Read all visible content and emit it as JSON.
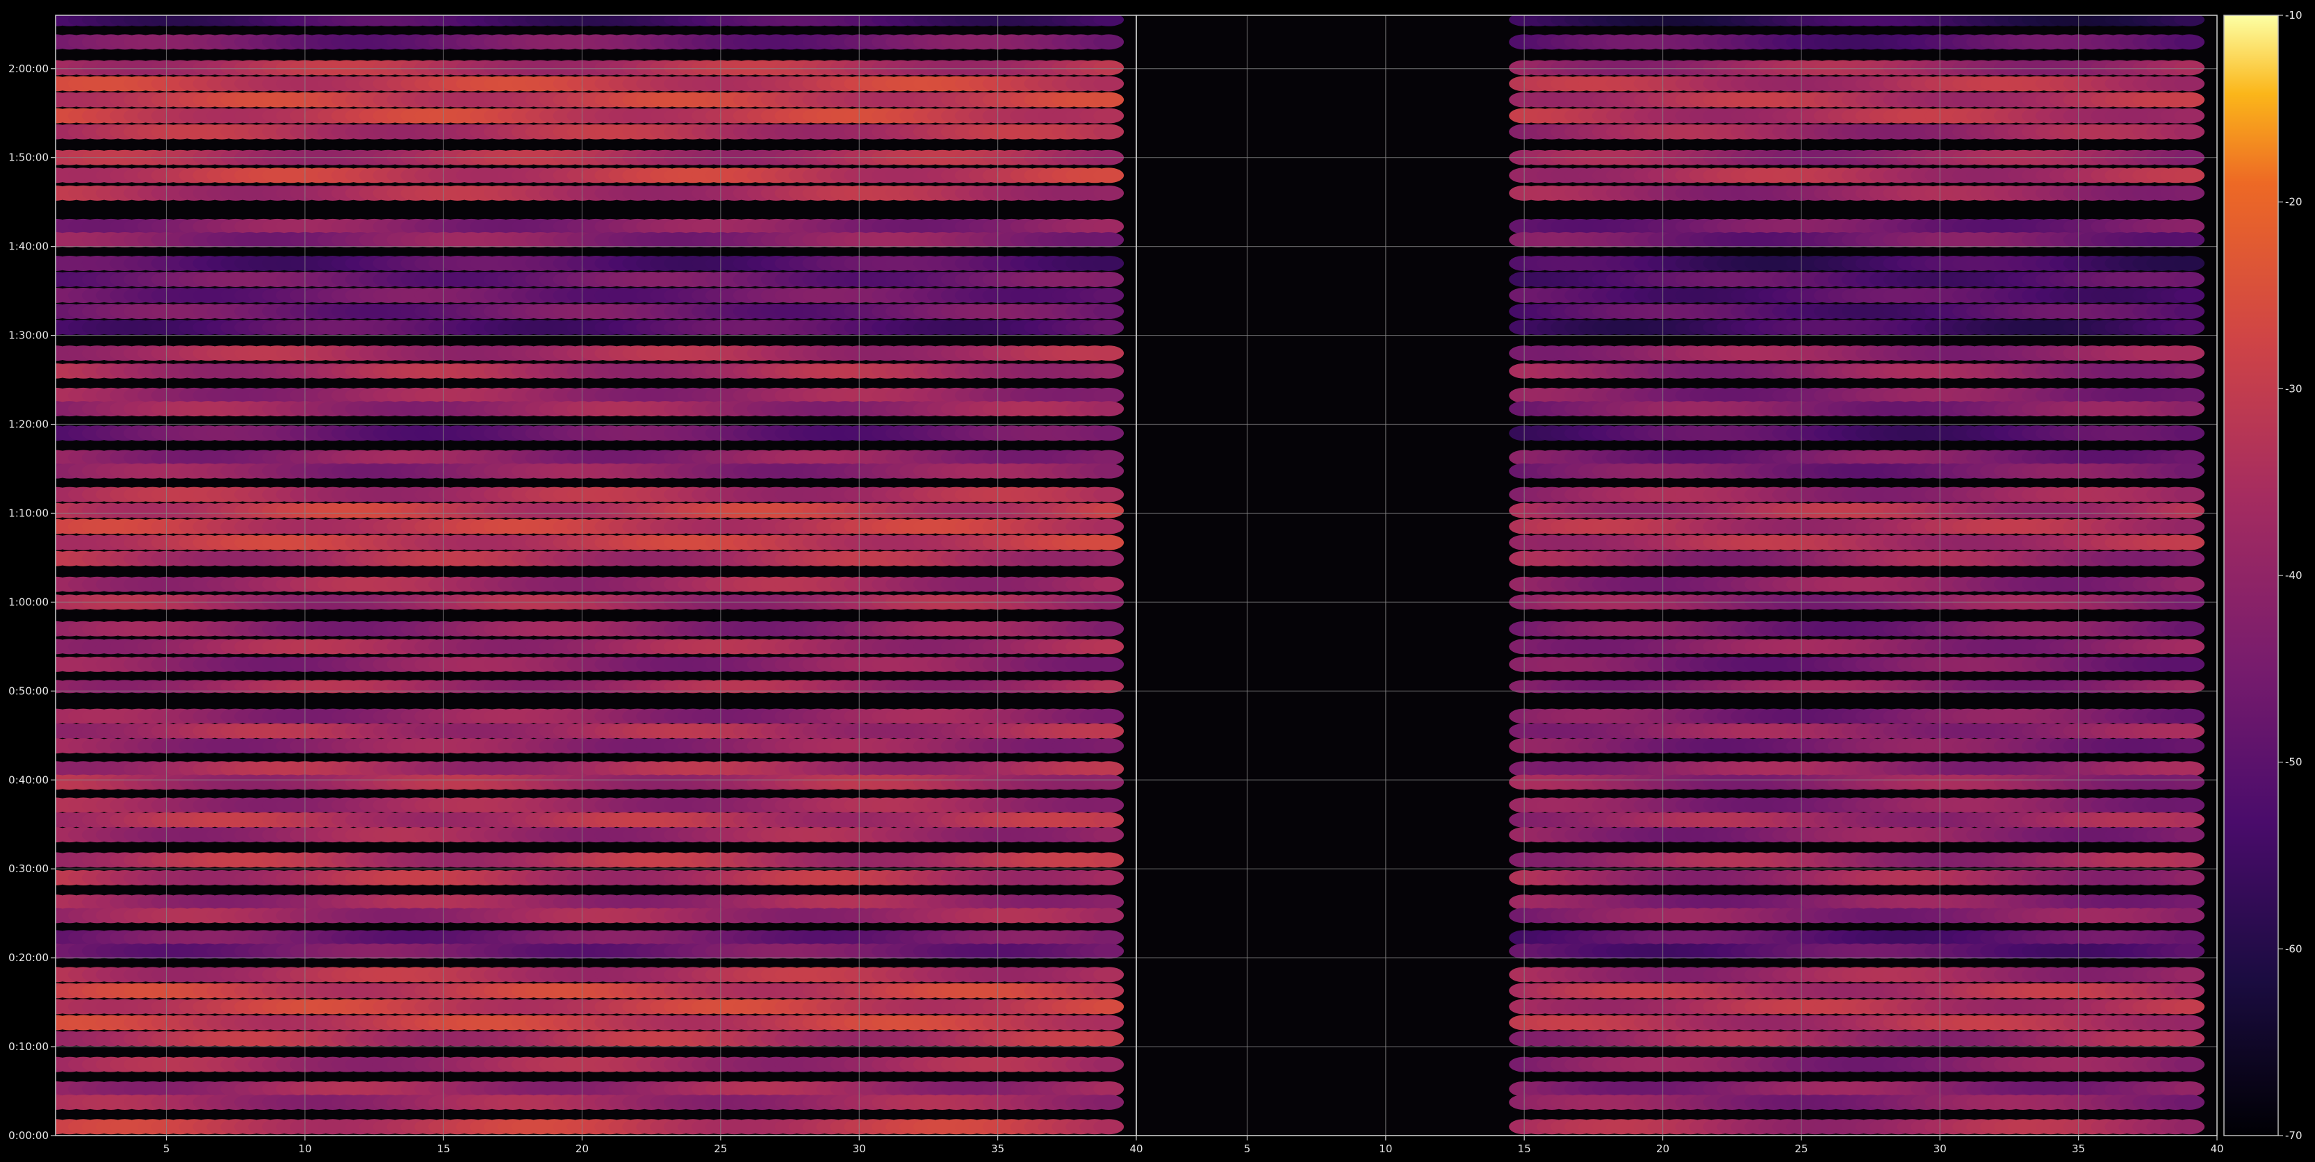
{
  "chart_data": [
    {
      "type": "heatmap",
      "title": "",
      "xlabel": "",
      "ylabel": "",
      "xlim": [
        1,
        40
      ],
      "ylim_seconds": [
        0,
        7560
      ],
      "x_ticks": [
        "5",
        "10",
        "15",
        "20",
        "25",
        "30",
        "35",
        "40"
      ],
      "x_tick_values": [
        5,
        10,
        15,
        20,
        25,
        30,
        35,
        40
      ],
      "y_ticks": [
        "0:00:00",
        "0:10:00",
        "0:20:00",
        "0:30:00",
        "0:40:00",
        "0:50:00",
        "1:00:00",
        "1:10:00",
        "1:20:00",
        "1:30:00",
        "1:40:00",
        "1:50:00",
        "2:00:00"
      ],
      "y_tick_values_seconds": [
        0,
        600,
        1200,
        1800,
        2400,
        3000,
        3600,
        4200,
        4800,
        5400,
        6000,
        6600,
        7200
      ],
      "grid": true,
      "bands_seconds": [
        [
          0,
          120,
          -27
        ],
        [
          180,
          360,
          -34
        ],
        [
          420,
          540,
          -33
        ],
        [
          600,
          1140,
          -30
        ],
        [
          1200,
          1380,
          -42
        ],
        [
          1440,
          1620,
          -34
        ],
        [
          1680,
          1920,
          -30
        ],
        [
          1980,
          2280,
          -34
        ],
        [
          2340,
          2520,
          -32
        ],
        [
          2580,
          2880,
          -36
        ],
        [
          3000,
          3060,
          -33
        ],
        [
          3120,
          3480,
          -37
        ],
        [
          3540,
          3780,
          -33
        ],
        [
          3840,
          4380,
          -31
        ],
        [
          4440,
          4620,
          -37
        ],
        [
          4680,
          4800,
          -44
        ],
        [
          4860,
          5040,
          -35
        ],
        [
          5100,
          5340,
          -32
        ],
        [
          5400,
          5940,
          -47
        ],
        [
          6000,
          6180,
          -38
        ],
        [
          6300,
          6660,
          -31
        ],
        [
          6720,
          7260,
          -30
        ],
        [
          7320,
          7440,
          -42
        ],
        [
          7500,
          7560,
          -50
        ]
      ],
      "active_x_range": [
        1,
        39
      ]
    },
    {
      "type": "heatmap",
      "title": "",
      "xlabel": "",
      "ylabel": "",
      "xlim": [
        1,
        40
      ],
      "ylim_seconds": [
        0,
        7560
      ],
      "x_ticks": [
        "5",
        "10",
        "15",
        "20",
        "25",
        "30",
        "35",
        "40"
      ],
      "x_tick_values": [
        5,
        10,
        15,
        20,
        25,
        30,
        35,
        40
      ],
      "grid": true,
      "bands_seconds": [
        [
          0,
          120,
          -32
        ],
        [
          180,
          360,
          -38
        ],
        [
          420,
          540,
          -38
        ],
        [
          600,
          1140,
          -34
        ],
        [
          1200,
          1380,
          -46
        ],
        [
          1440,
          1620,
          -38
        ],
        [
          1680,
          1920,
          -34
        ],
        [
          1980,
          2280,
          -38
        ],
        [
          2340,
          2520,
          -36
        ],
        [
          2580,
          2880,
          -40
        ],
        [
          3000,
          3060,
          -37
        ],
        [
          3120,
          3480,
          -41
        ],
        [
          3540,
          3780,
          -37
        ],
        [
          3840,
          4380,
          -35
        ],
        [
          4440,
          4620,
          -41
        ],
        [
          4680,
          4800,
          -48
        ],
        [
          4860,
          5040,
          -39
        ],
        [
          5100,
          5340,
          -36
        ],
        [
          5400,
          5940,
          -51
        ],
        [
          6000,
          6180,
          -42
        ],
        [
          6300,
          6660,
          -35
        ],
        [
          6720,
          7260,
          -34
        ],
        [
          7320,
          7440,
          -46
        ],
        [
          7500,
          7560,
          -54
        ]
      ],
      "active_x_range": [
        15,
        39
      ]
    }
  ],
  "colorbar": {
    "range": [
      -70,
      -10
    ],
    "ticks": [
      "-10",
      "-20",
      "-30",
      "-40",
      "-50",
      "-60",
      "-70"
    ],
    "tick_values": [
      -10,
      -20,
      -30,
      -40,
      -50,
      -60,
      -70
    ],
    "colormap": "inferno"
  }
}
